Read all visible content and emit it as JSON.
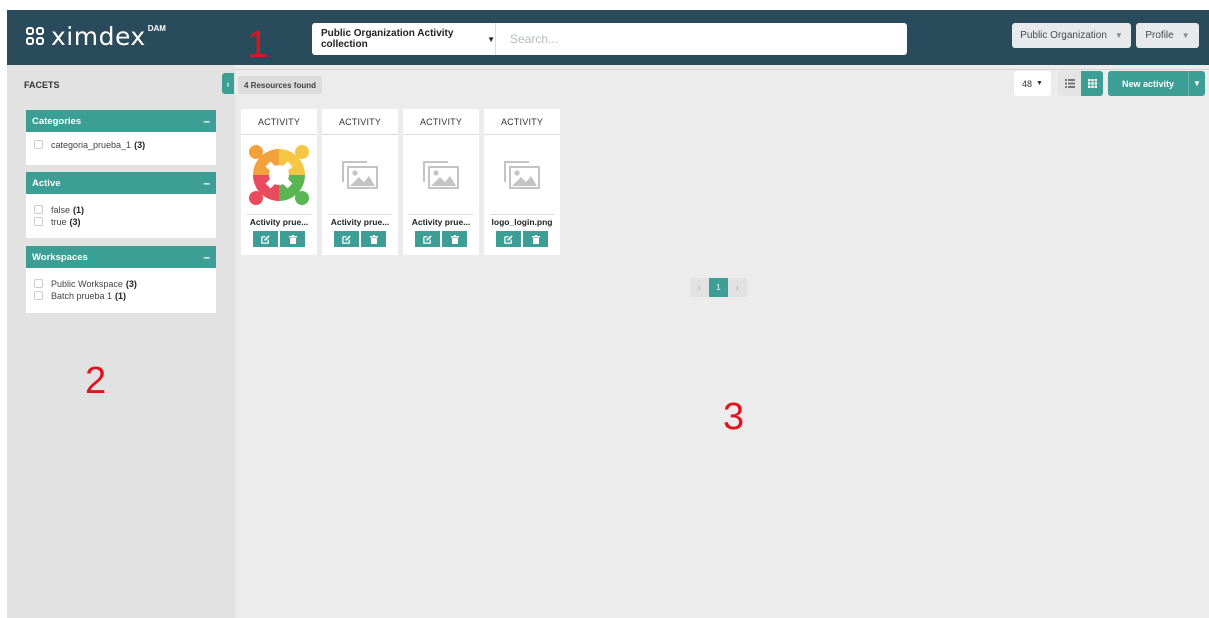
{
  "header": {
    "logo_text": "ximdex",
    "logo_sup": "DAM",
    "collection_label": "Public Organization Activity collection",
    "search_placeholder": "Search...",
    "org_button": "Public Organization",
    "profile_button": "Profile"
  },
  "sidebar": {
    "title": "FACETS",
    "panels": [
      {
        "title": "Categories",
        "items": [
          {
            "label": "categoria_prueba_1",
            "count": "(3)"
          }
        ]
      },
      {
        "title": "Active",
        "items": [
          {
            "label": "false",
            "count": "(1)"
          },
          {
            "label": "true",
            "count": "(3)"
          }
        ]
      },
      {
        "title": "Workspaces",
        "items": [
          {
            "label": "Public Workspace",
            "count": "(3)"
          },
          {
            "label": "Batch prueba 1",
            "count": "(1)"
          }
        ]
      }
    ]
  },
  "main": {
    "found": "4 Resources found",
    "per_page": "48",
    "new_button": "New activity",
    "cards": [
      {
        "type": "ACTIVITY",
        "name": "Activity prue...",
        "thumb": "colorful-people-logo"
      },
      {
        "type": "ACTIVITY",
        "name": "Activity prue...",
        "thumb": "image-placeholder-icon"
      },
      {
        "type": "ACTIVITY",
        "name": "Activity prue...",
        "thumb": "image-placeholder-icon"
      },
      {
        "type": "ACTIVITY",
        "name": "logo_login.png",
        "thumb": "image-placeholder-icon"
      }
    ],
    "pagination": {
      "prev": "‹",
      "current": "1",
      "next": "›"
    }
  },
  "annotations": [
    "1",
    "2",
    "3"
  ],
  "colors": {
    "topbar": "#2a4b5c",
    "accent": "#3d9e96",
    "annotation": "#e0141e"
  }
}
